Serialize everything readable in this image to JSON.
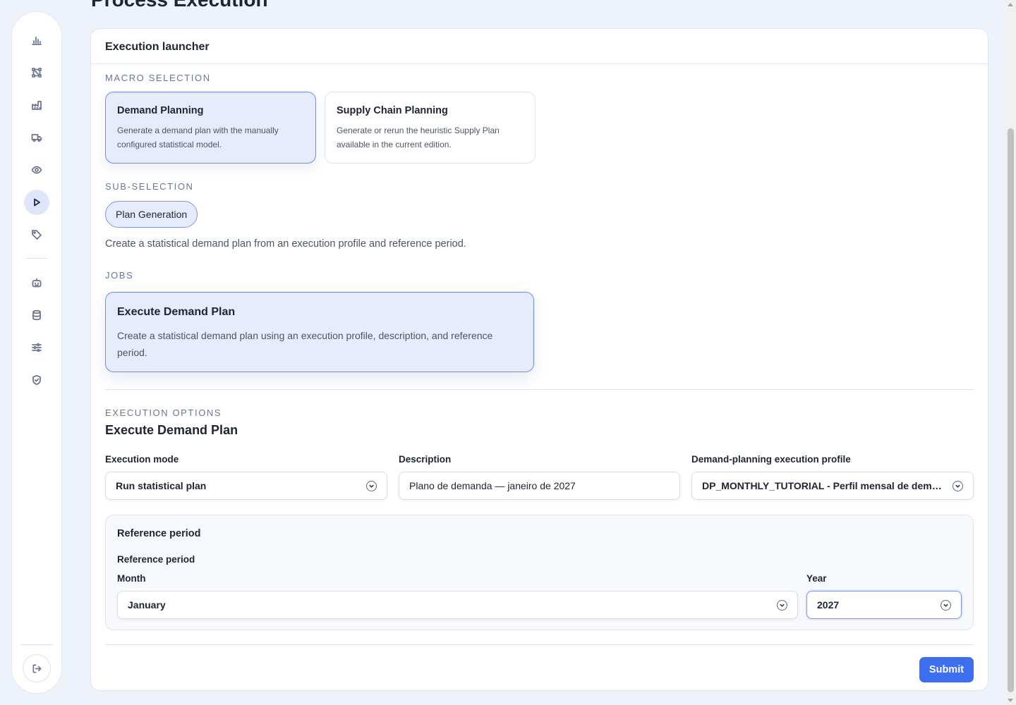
{
  "page": {
    "title": "Process Execution"
  },
  "card": {
    "header": "Execution launcher"
  },
  "macro": {
    "label": "MACRO SELECTION",
    "options": [
      {
        "title": "Demand Planning",
        "desc_line1": "Generate a demand plan with the manually",
        "desc_line2": "configured statistical model."
      },
      {
        "title": "Supply Chain Planning",
        "desc_line1": "Generate or rerun the heuristic Supply Plan",
        "desc_line2": "available in the current edition."
      }
    ]
  },
  "sub": {
    "label": "SUB-SELECTION",
    "chip": "Plan Generation",
    "description": "Create a statistical demand plan from an execution profile and reference period."
  },
  "jobs": {
    "label": "JOBS",
    "items": [
      {
        "title": "Execute Demand Plan",
        "desc_line1": "Create a statistical demand plan using an execution profile, description, and reference",
        "desc_line2": "period."
      }
    ]
  },
  "options": {
    "label": "EXECUTION OPTIONS",
    "title": "Execute Demand Plan",
    "execution_mode": {
      "label": "Execution mode",
      "value": "Run statistical plan"
    },
    "description": {
      "label": "Description",
      "value": "Plano de demanda — janeiro de 2027"
    },
    "profile": {
      "label": "Demand-planning execution profile",
      "value": "DP_MONTHLY_TUTORIAL - Perfil mensal de demanda"
    },
    "reference": {
      "title": "Reference period",
      "subtitle": "Reference period",
      "month": {
        "label": "Month",
        "value": "January"
      },
      "year": {
        "label": "Year",
        "value": "2027"
      }
    }
  },
  "actions": {
    "submit": "Submit"
  },
  "sidebar": {
    "icons": [
      "chart-icon",
      "workflow-icon",
      "factory-icon",
      "truck-icon",
      "eye-icon",
      "play-icon",
      "tag-icon",
      "robot-icon",
      "database-icon",
      "sliders-icon",
      "shield-check-icon",
      "logout-icon"
    ],
    "active": "play-icon"
  },
  "colors": {
    "accent": "#3b6ff0",
    "selected_bg": "#e6ecfc",
    "page_bg": "#eef2fa"
  }
}
